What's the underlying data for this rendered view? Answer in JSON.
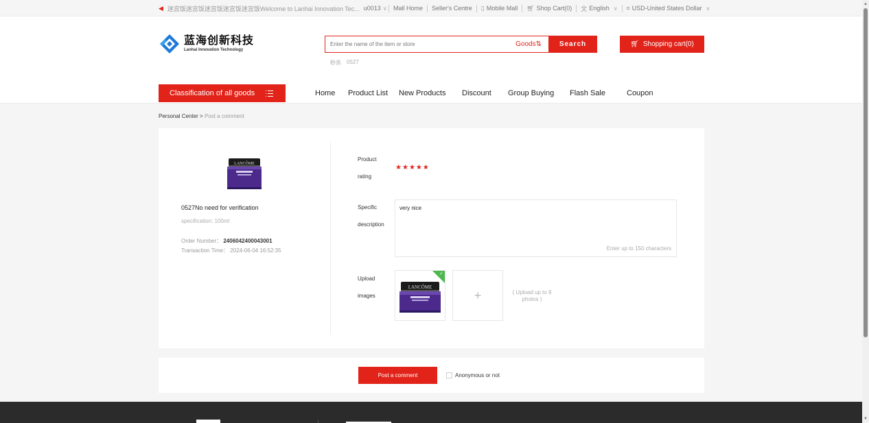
{
  "topbar": {
    "welcome": "迷宫饭迷宫饭迷宫饭迷宫饭迷宫饭Welcome to Lanhai Innovation Tec...",
    "user": "u0013",
    "mall_home": "Mall Home",
    "sellers_centre": "Seller's Centre",
    "mobile_mall": "Mobile Mall",
    "shop_cart": "Shop Cart(0)",
    "language": "English",
    "currency": "USD-United States Dollar"
  },
  "logo": {
    "cn": "蓝海创新科技",
    "en": "Lanhai Innovation Technology",
    "colors": {
      "blue": "#1e7ad8"
    }
  },
  "search": {
    "placeholder": "Enter the name of the item or store",
    "scope": "Goods⇅",
    "button": "Search",
    "hotwords": [
      "秒杀",
      "0527"
    ]
  },
  "cart_button": "Shopping cart(0)",
  "nav": {
    "category_button": "Classification of all goods",
    "links": [
      "Home",
      "Product List",
      "New Products",
      "Discount",
      "Group Buying",
      "Flash Sale",
      "Coupon"
    ]
  },
  "breadcrumb": {
    "parent": "Personal Center",
    "separator": ">",
    "current": "Post a comment"
  },
  "product": {
    "name": "0527No need for verification",
    "spec": "specification: 100ml",
    "order_label": "Order Number：",
    "order_number": "2406042400043001",
    "time_label": "Transaction Time：",
    "time": "2024-06-04 16:52:35",
    "image_icon": "cream-jar-image"
  },
  "form": {
    "rating_label_1": "Product",
    "rating_label_2": "rating",
    "rating": 5,
    "rating_max": 5,
    "desc_label_1": "Specific",
    "desc_label_2": "description",
    "desc_value": "very nice",
    "desc_hint": "Enter up to 150 characters",
    "upload_label_1": "Upload",
    "upload_label_2": "images",
    "upload_add": "+",
    "upload_note": "( Upload up to 9 photos )"
  },
  "post": {
    "button": "Post a comment",
    "anonymous": "Anonymous or not"
  },
  "colors": {
    "accent": "#e2231a",
    "check": "#4cb84c",
    "footer": "#2b2b2b"
  }
}
